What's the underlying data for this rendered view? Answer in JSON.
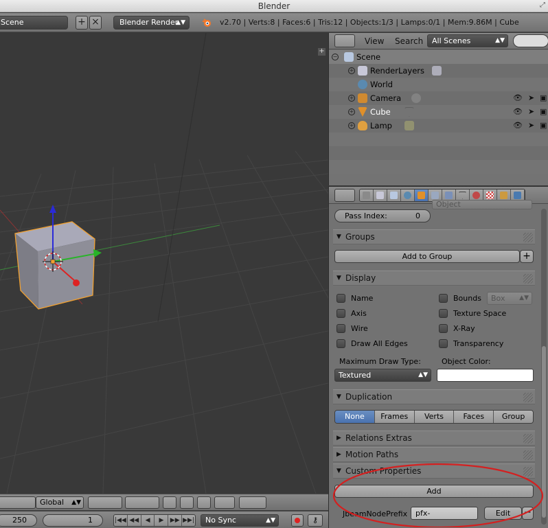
{
  "window": {
    "title": "Blender"
  },
  "info_header": {
    "scene_value": "Scene",
    "render_engine": "Blender Render",
    "stats": "v2.70 | Verts:8 | Faces:6 | Tris:12 | Objects:1/3 | Lamps:0/1 | Mem:9.86M | Cube"
  },
  "viewport_header": {
    "orientation": "Global"
  },
  "timeline": {
    "end_frame": "250",
    "current_frame": "1",
    "sync_mode": "No Sync"
  },
  "outliner": {
    "menu": [
      "View",
      "Search"
    ],
    "display_mode": "All Scenes",
    "tree": [
      {
        "label": "Scene"
      },
      {
        "label": "RenderLayers"
      },
      {
        "label": "World"
      },
      {
        "label": "Camera"
      },
      {
        "label": "Cube"
      },
      {
        "label": "Lamp"
      }
    ]
  },
  "properties": {
    "clipped_top_value": "Object",
    "pass_index": {
      "label": "Pass Index:",
      "value": "0"
    },
    "groups": {
      "title": "Groups",
      "add_label": "Add to Group"
    },
    "display": {
      "title": "Display",
      "left_checks": [
        "Name",
        "Axis",
        "Wire",
        "Draw All Edges"
      ],
      "right_checks": [
        "Bounds",
        "Texture Space",
        "X-Ray",
        "Transparency"
      ],
      "bounds_type": "Box",
      "max_draw_label": "Maximum Draw Type:",
      "max_draw_value": "Textured",
      "color_label": "Object Color:"
    },
    "duplication": {
      "title": "Duplication",
      "options": [
        "None",
        "Frames",
        "Verts",
        "Faces",
        "Group"
      ],
      "active": "None"
    },
    "relations_extras": "Relations Extras",
    "motion_paths": "Motion Paths",
    "custom_properties": {
      "title": "Custom Properties",
      "add_label": "Add",
      "prop_name": "JbeamNodePrefix",
      "prop_value": "pfx-",
      "edit_label": "Edit"
    }
  },
  "colors": {
    "active_blue": "#5680c2",
    "annotation_red": "#d42020",
    "selection_orange": "#f0a030"
  }
}
